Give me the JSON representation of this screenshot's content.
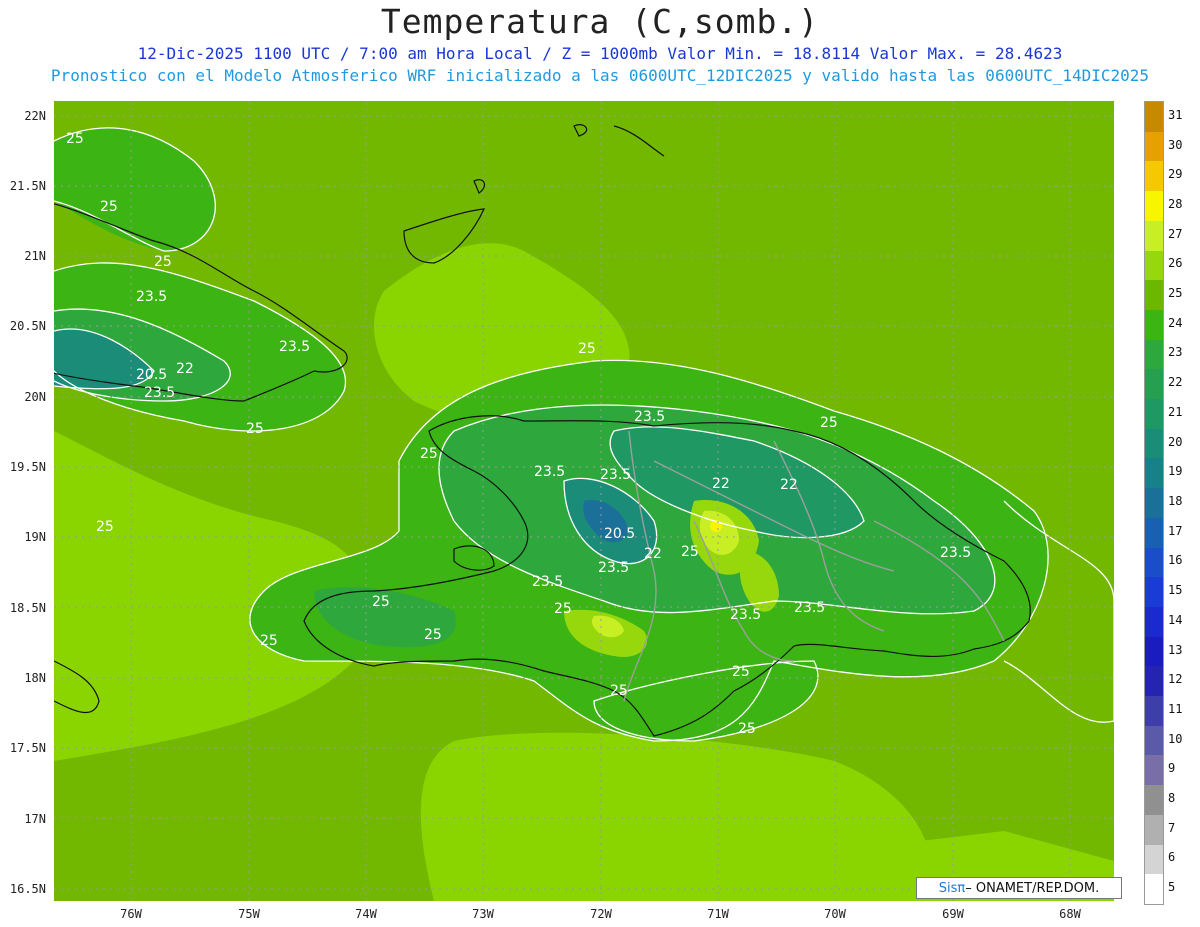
{
  "header": {
    "title": "Temperatura (C,somb.)",
    "line1": "12-Dic-2025  1100 UTC / 7:00 am Hora Local / Z = 1000mb   Valor Min. = 18.8114  Valor Max. = 28.4623",
    "line2": "Pronostico con el Modelo Atmosferico WRF inicializado a las 0600UTC_12DIC2025 y valido hasta las  0600UTC_14DIC2025"
  },
  "axes": {
    "lat_labels": [
      "22N",
      "21.5N",
      "21N",
      "20.5N",
      "20N",
      "19.5N",
      "19N",
      "18.5N",
      "18N",
      "17.5N",
      "17N",
      "16.5N"
    ],
    "lon_labels": [
      "76W",
      "75W",
      "74W",
      "73W",
      "72W",
      "71W",
      "70W",
      "69W",
      "68W"
    ]
  },
  "contour_labels": [
    "25",
    "25",
    "25",
    "23.5",
    "23.5",
    "22",
    "20.5",
    "23.5",
    "25",
    "25",
    "25",
    "23.5",
    "23.5",
    "23.5",
    "22",
    "22",
    "20.5",
    "22",
    "25",
    "23.5",
    "25",
    "25",
    "23.5",
    "23.5",
    "23.5",
    "25",
    "25",
    "25",
    "25",
    "25",
    "25",
    "25",
    "23.5"
  ],
  "colorbar": {
    "levels": [
      "31",
      "30",
      "29",
      "28",
      "27",
      "26",
      "25",
      "24",
      "23",
      "22",
      "21",
      "20",
      "19",
      "18",
      "17",
      "16",
      "15",
      "14",
      "13",
      "12",
      "11",
      "10",
      "9",
      "8",
      "7",
      "6",
      "5"
    ],
    "colors": [
      "#c68a00",
      "#e4a100",
      "#f6c800",
      "#f7f500",
      "#c8ee24",
      "#96d80c",
      "#6cb800",
      "#3cb414",
      "#2ea83c",
      "#26a050",
      "#1f9864",
      "#1a8c78",
      "#188088",
      "#1a7098",
      "#1a60b0",
      "#1a4ec8",
      "#1a3cd6",
      "#1a2ad0",
      "#1a1cc0",
      "#2424b0",
      "#3e3ea8",
      "#5a5aa8",
      "#7a6ea8",
      "#909090",
      "#b0b0b0",
      "#d4d4d4",
      "#ffffff"
    ]
  },
  "credit": {
    "pi": "Sisπ",
    "rest": " – ONAMET/REP.DOM."
  }
}
